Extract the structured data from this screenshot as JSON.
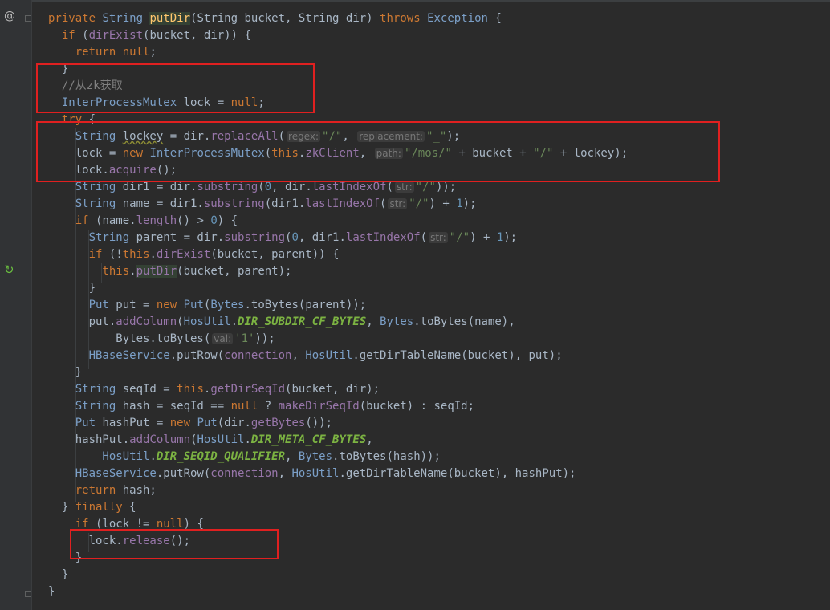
{
  "gutter": {
    "override_icon": "@",
    "recursion_icon": "↻"
  },
  "code_lines": [
    [
      [
        "kw",
        "private "
      ],
      [
        "ty",
        "String "
      ],
      [
        "fn hi",
        "putDir"
      ],
      [
        "",
        "(String bucket, String dir) "
      ],
      [
        "kw",
        "throws "
      ],
      [
        "ty",
        "Exception "
      ],
      [
        "",
        "{"
      ]
    ],
    [
      [
        "kw",
        "  if "
      ],
      [
        "",
        "("
      ],
      [
        "mc",
        "dirExist"
      ],
      [
        "",
        "(bucket, dir)) {"
      ]
    ],
    [
      [
        "kw",
        "    return null"
      ],
      [
        "",
        ";"
      ]
    ],
    [
      [
        "",
        "  }"
      ]
    ],
    [
      [
        "cm",
        "  //从zk获取"
      ]
    ],
    [
      [
        "ty",
        "  InterProcessMutex "
      ],
      [
        "",
        "lock = "
      ],
      [
        "kw",
        "null"
      ],
      [
        "",
        ";"
      ]
    ],
    [
      [
        "kw",
        "  try "
      ],
      [
        "",
        "{"
      ]
    ],
    [
      [
        "ty",
        "    String "
      ],
      [
        "und",
        "lockey"
      ],
      [
        "",
        " = dir."
      ],
      [
        "mc",
        "replaceAll"
      ],
      [
        "",
        "("
      ],
      [
        "hint",
        "regex:"
      ],
      [
        "st",
        "\"/\""
      ],
      [
        "",
        ", "
      ],
      [
        "hint",
        "replacement:"
      ],
      [
        "st",
        "\"_\""
      ],
      [
        "",
        ");"
      ]
    ],
    [
      [
        "",
        "    lock = "
      ],
      [
        "kw",
        "new "
      ],
      [
        "ty",
        "InterProcessMutex"
      ],
      [
        "",
        "("
      ],
      [
        "kw",
        "this"
      ],
      [
        "",
        "."
      ],
      [
        "mc",
        "zkClient"
      ],
      [
        "",
        ", "
      ],
      [
        "hint",
        "path:"
      ],
      [
        "st",
        "\"/mos/\""
      ],
      [
        "",
        " + bucket + "
      ],
      [
        "st",
        "\"/\""
      ],
      [
        "",
        " + lockey);"
      ]
    ],
    [
      [
        "",
        "    lock."
      ],
      [
        "mc",
        "acquire"
      ],
      [
        "",
        "();"
      ]
    ],
    [
      [
        "ty",
        "    String "
      ],
      [
        "",
        "dir1 = dir."
      ],
      [
        "mc",
        "substring"
      ],
      [
        "",
        "("
      ],
      [
        "nm",
        "0"
      ],
      [
        "",
        ", dir."
      ],
      [
        "mc",
        "lastIndexOf"
      ],
      [
        "",
        "("
      ],
      [
        "hint",
        "str:"
      ],
      [
        "st",
        "\"/\""
      ],
      [
        "",
        "));"
      ]
    ],
    [
      [
        "ty",
        "    String "
      ],
      [
        "",
        "name = dir1."
      ],
      [
        "mc",
        "substring"
      ],
      [
        "",
        "(dir1."
      ],
      [
        "mc",
        "lastIndexOf"
      ],
      [
        "",
        "("
      ],
      [
        "hint",
        "str:"
      ],
      [
        "st",
        "\"/\""
      ],
      [
        "",
        ") + "
      ],
      [
        "nm",
        "1"
      ],
      [
        "",
        ");"
      ]
    ],
    [
      [
        "kw",
        "    if "
      ],
      [
        "",
        "(name."
      ],
      [
        "mc",
        "length"
      ],
      [
        "",
        "() > "
      ],
      [
        "nm",
        "0"
      ],
      [
        "",
        ") {"
      ]
    ],
    [
      [
        "ty",
        "      String "
      ],
      [
        "",
        "parent = dir."
      ],
      [
        "mc",
        "substring"
      ],
      [
        "",
        "("
      ],
      [
        "nm",
        "0"
      ],
      [
        "",
        ", dir1."
      ],
      [
        "mc",
        "lastIndexOf"
      ],
      [
        "",
        "("
      ],
      [
        "hint",
        "str:"
      ],
      [
        "st",
        "\"/\""
      ],
      [
        "",
        ") + "
      ],
      [
        "nm",
        "1"
      ],
      [
        "",
        ");"
      ]
    ],
    [
      [
        "kw",
        "      if "
      ],
      [
        "",
        "(!"
      ],
      [
        "kw",
        "this"
      ],
      [
        "",
        "."
      ],
      [
        "mc",
        "dirExist"
      ],
      [
        "",
        "(bucket, parent)) {"
      ]
    ],
    [
      [
        "kw",
        "        this"
      ],
      [
        "",
        "."
      ],
      [
        "mc hi",
        "putDir"
      ],
      [
        "",
        "(bucket, parent);"
      ]
    ],
    [
      [
        "",
        "      }"
      ]
    ],
    [
      [
        "ty",
        "      Put "
      ],
      [
        "",
        "put = "
      ],
      [
        "kw",
        "new "
      ],
      [
        "ty",
        "Put"
      ],
      [
        "",
        "("
      ],
      [
        "ty",
        "Bytes"
      ],
      [
        "",
        ".toBytes(parent));"
      ]
    ],
    [
      [
        "",
        "      put."
      ],
      [
        "mc",
        "addColumn"
      ],
      [
        "",
        "("
      ],
      [
        "ty",
        "HosUtil"
      ],
      [
        "",
        "."
      ],
      [
        "cf",
        "DIR_SUBDIR_CF_BYTES"
      ],
      [
        "",
        ", "
      ],
      [
        "ty",
        "Bytes"
      ],
      [
        "",
        ".toBytes(name),"
      ]
    ],
    [
      [
        "",
        "          Bytes.toBytes("
      ],
      [
        "hint",
        "val:"
      ],
      [
        "st",
        "'1'"
      ],
      [
        "",
        "));"
      ]
    ],
    [
      [
        "ty",
        "      HBaseService"
      ],
      [
        "",
        ".putRow("
      ],
      [
        "mc",
        "connection"
      ],
      [
        "",
        ", "
      ],
      [
        "ty",
        "HosUtil"
      ],
      [
        "",
        ".getDirTableName(bucket), put);"
      ]
    ],
    [
      [
        "",
        "    }"
      ]
    ],
    [
      [
        "ty",
        "    String "
      ],
      [
        "",
        "seqId = "
      ],
      [
        "kw",
        "this"
      ],
      [
        "",
        "."
      ],
      [
        "mc",
        "getDirSeqId"
      ],
      [
        "",
        "(bucket, dir);"
      ]
    ],
    [
      [
        "ty",
        "    String "
      ],
      [
        "",
        "hash = seqId == "
      ],
      [
        "kw",
        "null "
      ],
      [
        "",
        "? "
      ],
      [
        "mc",
        "makeDirSeqId"
      ],
      [
        "",
        "(bucket) : seqId;"
      ]
    ],
    [
      [
        "ty",
        "    Put "
      ],
      [
        "",
        "hashPut = "
      ],
      [
        "kw",
        "new "
      ],
      [
        "ty",
        "Put"
      ],
      [
        "",
        "(dir."
      ],
      [
        "mc",
        "getBytes"
      ],
      [
        "",
        "());"
      ]
    ],
    [
      [
        "",
        "    hashPut."
      ],
      [
        "mc",
        "addColumn"
      ],
      [
        "",
        "("
      ],
      [
        "ty",
        "HosUtil"
      ],
      [
        "",
        "."
      ],
      [
        "cf",
        "DIR_META_CF_BYTES"
      ],
      [
        "",
        ","
      ]
    ],
    [
      [
        "ty",
        "        HosUtil"
      ],
      [
        "",
        "."
      ],
      [
        "cf",
        "DIR_SEQID_QUALIFIER"
      ],
      [
        "",
        ", "
      ],
      [
        "ty",
        "Bytes"
      ],
      [
        "",
        ".toBytes(hash));"
      ]
    ],
    [
      [
        "ty",
        "    HBaseService"
      ],
      [
        "",
        ".putRow("
      ],
      [
        "mc",
        "connection"
      ],
      [
        "",
        ", "
      ],
      [
        "ty",
        "HosUtil"
      ],
      [
        "",
        ".getDirTableName(bucket), hashPut);"
      ]
    ],
    [
      [
        "kw",
        "    return "
      ],
      [
        "",
        "hash;"
      ]
    ],
    [
      [
        "",
        "  } "
      ],
      [
        "kw",
        "finally "
      ],
      [
        "",
        "{"
      ]
    ],
    [
      [
        "kw",
        "    if "
      ],
      [
        "",
        "(lock != "
      ],
      [
        "kw",
        "null"
      ],
      [
        "",
        ") {"
      ]
    ],
    [
      [
        "",
        "      lock."
      ],
      [
        "mc",
        "release"
      ],
      [
        "",
        "();"
      ]
    ],
    [
      [
        "",
        "    }"
      ]
    ],
    [
      [
        "",
        "  }"
      ]
    ],
    [
      [
        "",
        "}"
      ]
    ]
  ]
}
